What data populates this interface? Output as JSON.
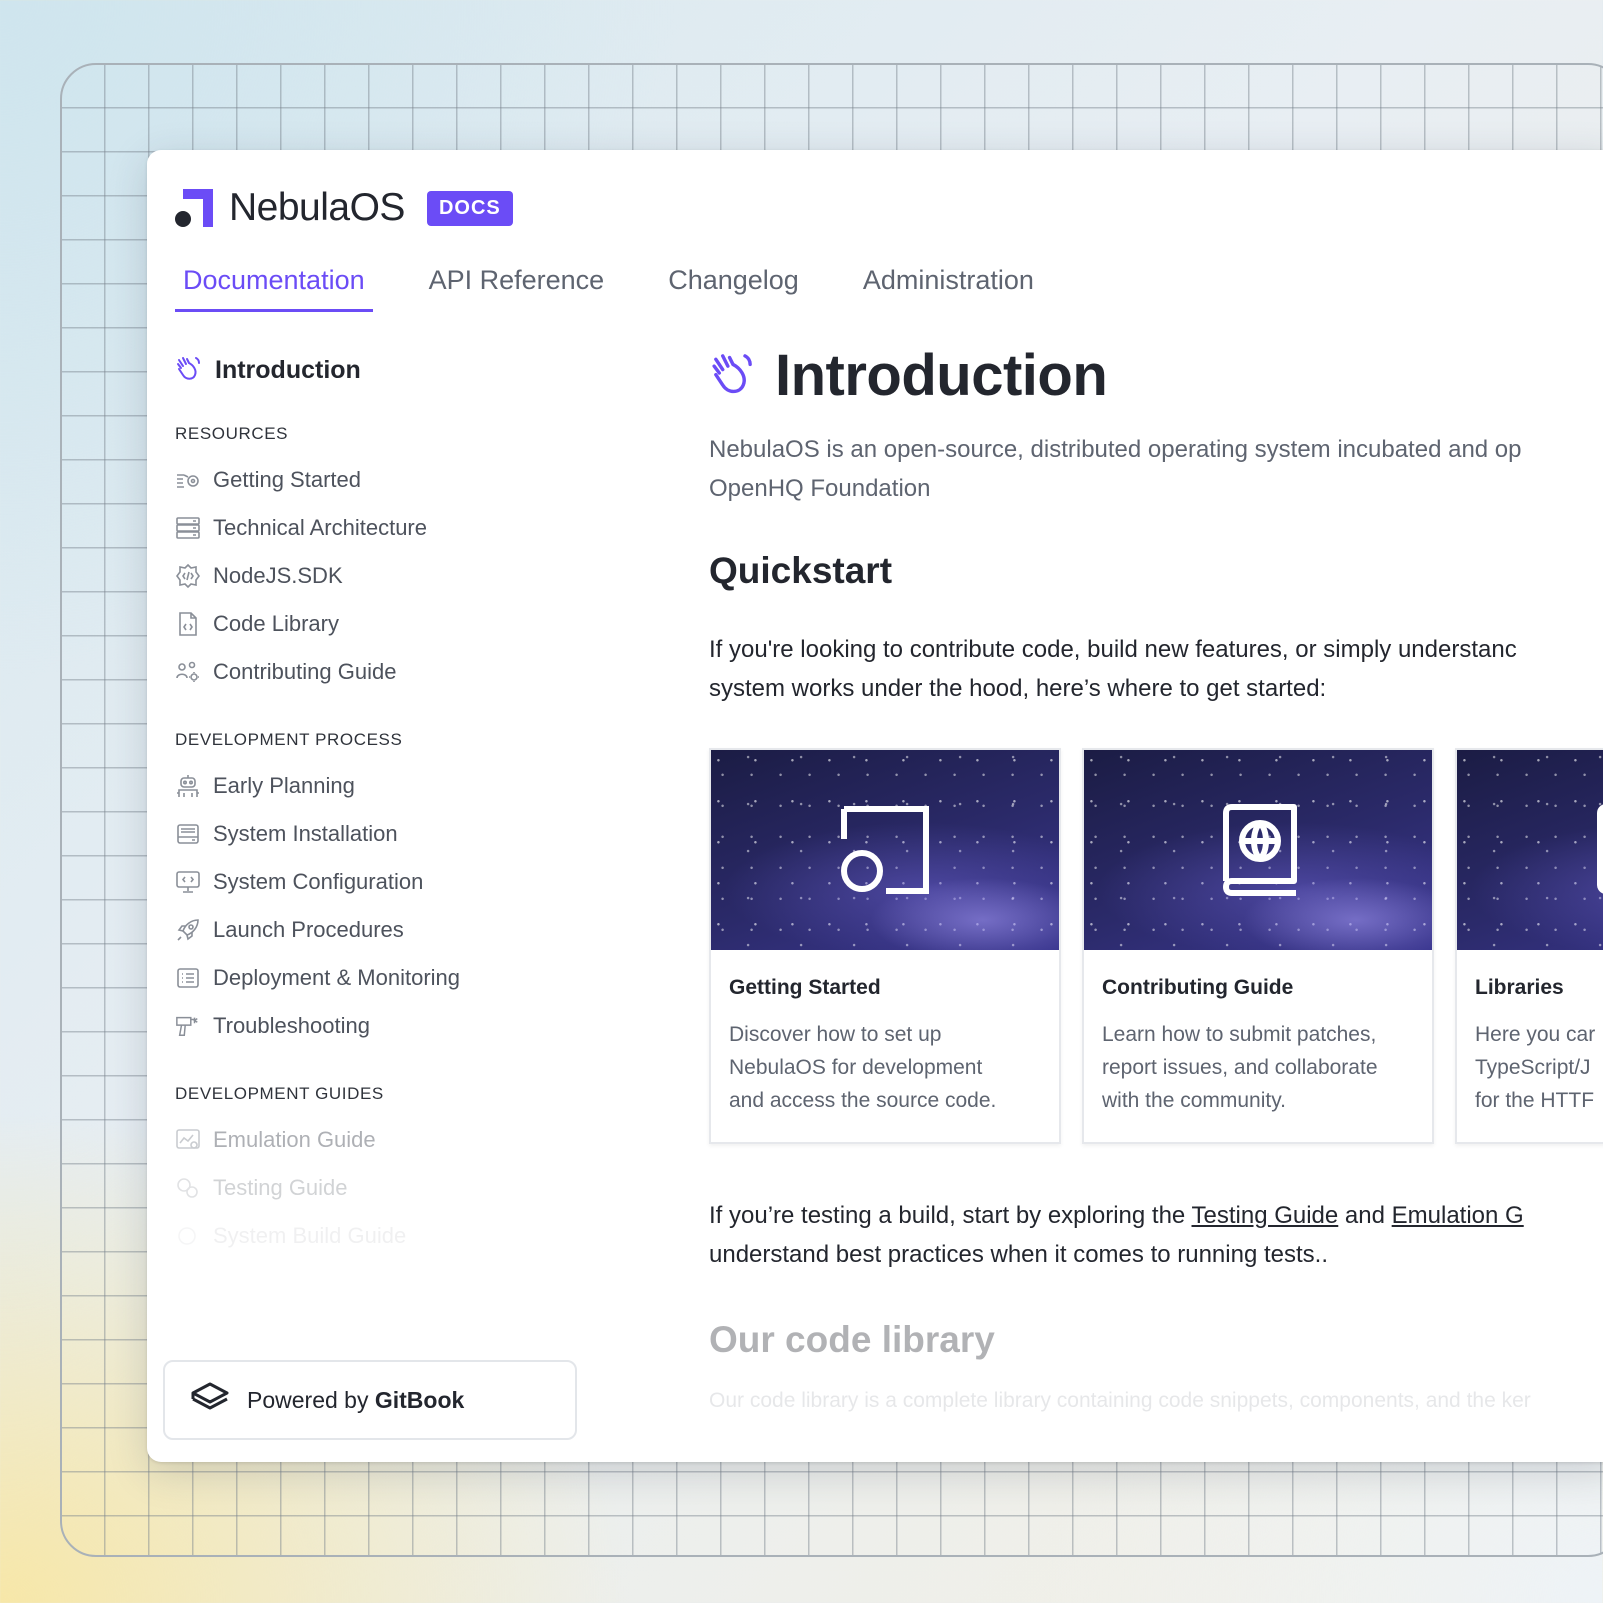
{
  "brand": {
    "name": "NebulaOS",
    "badge": "DOCS",
    "accent": "#6b4cf6"
  },
  "tabs": [
    {
      "label": "Documentation",
      "active": true
    },
    {
      "label": "API Reference",
      "active": false
    },
    {
      "label": "Changelog",
      "active": false
    },
    {
      "label": "Administration",
      "active": false
    }
  ],
  "sidebar": {
    "intro": "Introduction",
    "sections": [
      {
        "heading": "RESOURCES",
        "items": [
          {
            "label": "Getting Started",
            "icon": "binoculars-icon"
          },
          {
            "label": "Technical Architecture",
            "icon": "server-icon"
          },
          {
            "label": "NodeJS.SDK",
            "icon": "code-gear-icon"
          },
          {
            "label": "Code Library",
            "icon": "code-file-icon"
          },
          {
            "label": "Contributing Guide",
            "icon": "users-gear-icon"
          }
        ]
      },
      {
        "heading": "DEVELOPMENT PROCESS",
        "items": [
          {
            "label": "Early Planning",
            "icon": "robot-icon"
          },
          {
            "label": "System Installation",
            "icon": "drive-icon"
          },
          {
            "label": "System Configuration",
            "icon": "monitor-code-icon"
          },
          {
            "label": "Launch Procedures",
            "icon": "rocket-icon"
          },
          {
            "label": "Deployment & Monitoring",
            "icon": "list-icon"
          },
          {
            "label": "Troubleshooting",
            "icon": "drill-icon"
          }
        ]
      },
      {
        "heading": "DEVELOPMENT GUIDES",
        "items": [
          {
            "label": "Emulation Guide",
            "icon": "chart-gear-icon"
          },
          {
            "label": "Testing Guide",
            "icon": "flask-icon"
          },
          {
            "label": "System Build Guide",
            "icon": "build-icon"
          }
        ]
      }
    ],
    "powered": {
      "prefix": "Powered by ",
      "brand": "GitBook"
    }
  },
  "main": {
    "title": "Introduction",
    "lead_line1": "NebulaOS is an open-source, distributed operating system incubated and op",
    "lead_line2": "OpenHQ Foundation",
    "quickstart": "Quickstart",
    "para_line1": "If you're looking to contribute code, build new features, or simply understanc",
    "para_line2": "system works under the hood, here’s where to get started:",
    "cards": [
      {
        "title": "Getting Started",
        "desc": [
          "Discover how to set up",
          "NebulaOS for development",
          "and access the source code."
        ],
        "icon": "nebula-logo-icon"
      },
      {
        "title": "Contributing Guide",
        "desc": [
          "Learn how to submit patches,",
          "report issues, and collaborate",
          "with the community."
        ],
        "icon": "globe-book-icon"
      },
      {
        "title": "Libraries",
        "desc": [
          "Here you car",
          "TypeScript/J",
          "for the HTTF"
        ],
        "icon": "library-icon"
      }
    ],
    "testing_pre": "If you’re testing a build, start by exploring the ",
    "testing_link1": "Testing Guide",
    "testing_mid": " and ",
    "testing_link2": "Emulation G",
    "testing_line2": "understand best practices when it comes to running tests..",
    "library_heading": "Our code library",
    "library_text": "Our code library is a complete library containing code snippets, components, and the ker"
  }
}
